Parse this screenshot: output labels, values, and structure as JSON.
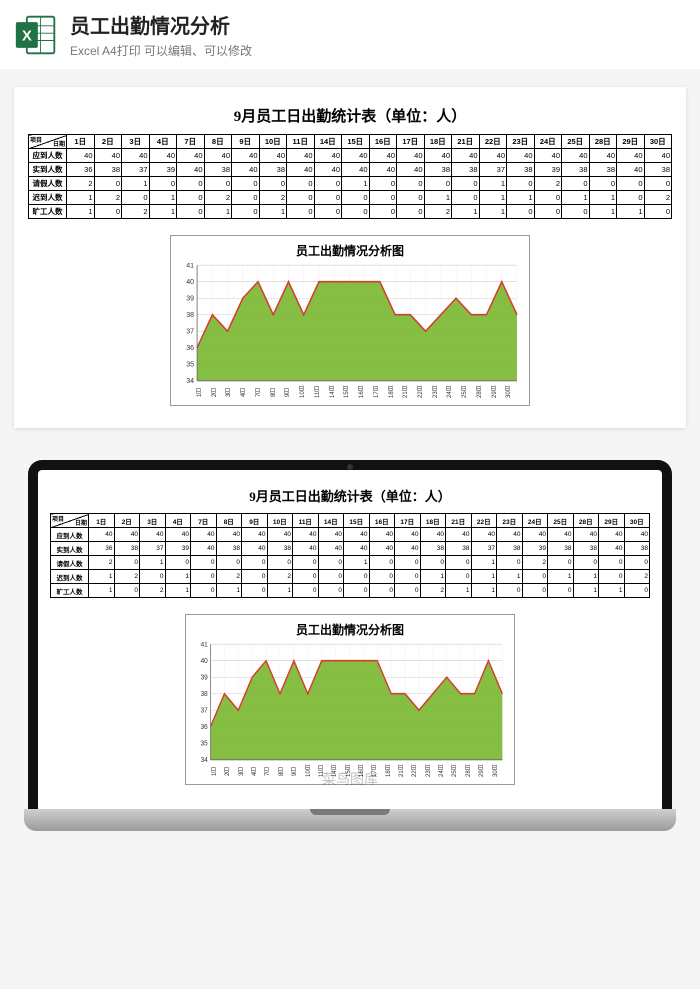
{
  "header": {
    "title": "员工出勤情况分析",
    "subtitle": "Excel A4打印 可以编辑、可以修改"
  },
  "doc_title": "9月员工日出勤统计表（单位：人）",
  "diag_top": "日期",
  "diag_bottom": "项目",
  "day_headers": [
    "1日",
    "2日",
    "3日",
    "4日",
    "7日",
    "8日",
    "9日",
    "10日",
    "11日",
    "14日",
    "15日",
    "16日",
    "17日",
    "18日",
    "21日",
    "22日",
    "23日",
    "24日",
    "25日",
    "28日",
    "29日",
    "30日"
  ],
  "rows": [
    {
      "label": "应到人数",
      "values": [
        40,
        40,
        40,
        40,
        40,
        40,
        40,
        40,
        40,
        40,
        40,
        40,
        40,
        40,
        40,
        40,
        40,
        40,
        40,
        40,
        40,
        40
      ]
    },
    {
      "label": "实到人数",
      "values": [
        36,
        38,
        37,
        39,
        40,
        38,
        40,
        38,
        40,
        40,
        40,
        40,
        40,
        38,
        38,
        37,
        38,
        39,
        38,
        38,
        40,
        38
      ]
    },
    {
      "label": "请假人数",
      "values": [
        2,
        0,
        1,
        0,
        0,
        0,
        0,
        0,
        0,
        0,
        1,
        0,
        0,
        0,
        0,
        1,
        0,
        2,
        0,
        0,
        0,
        0
      ]
    },
    {
      "label": "迟到人数",
      "values": [
        1,
        2,
        0,
        1,
        0,
        2,
        0,
        2,
        0,
        0,
        0,
        0,
        0,
        1,
        0,
        1,
        1,
        0,
        1,
        1,
        0,
        2
      ]
    },
    {
      "label": "旷工人数",
      "values": [
        1,
        0,
        2,
        1,
        0,
        1,
        0,
        1,
        0,
        0,
        0,
        0,
        0,
        2,
        1,
        1,
        0,
        0,
        0,
        1,
        1,
        0
      ]
    }
  ],
  "chart_title": "员工出勤情况分析图",
  "watermark": "菜鸟图库",
  "chart_data": {
    "type": "area",
    "title": "员工出勤情况分析图",
    "xlabel": "",
    "ylabel": "",
    "ylim": [
      34,
      41
    ],
    "yticks": [
      34,
      35,
      36,
      37,
      38,
      39,
      40,
      41
    ],
    "categories": [
      "1日",
      "2日",
      "3日",
      "4日",
      "7日",
      "8日",
      "9日",
      "10日",
      "11日",
      "14日",
      "15日",
      "16日",
      "17日",
      "18日",
      "21日",
      "22日",
      "23日",
      "24日",
      "25日",
      "28日",
      "29日",
      "30日"
    ],
    "values": [
      36,
      38,
      37,
      39,
      40,
      38,
      40,
      38,
      40,
      40,
      40,
      40,
      40,
      38,
      38,
      37,
      38,
      39,
      38,
      38,
      40,
      38
    ],
    "fill_color": "#7fba3a",
    "line_color": "#d43d2e"
  }
}
